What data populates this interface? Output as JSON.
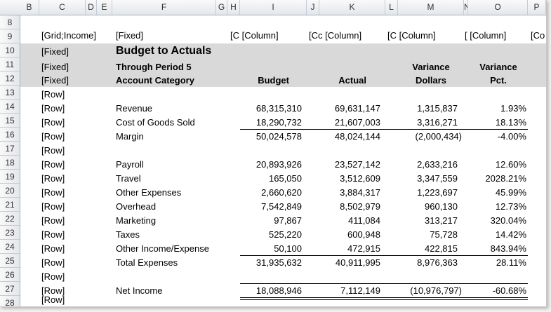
{
  "columns": [
    "B",
    "C",
    "D",
    "E",
    "F",
    "G",
    "H",
    "I",
    "J",
    "K",
    "L",
    "M",
    "N",
    "O",
    "P"
  ],
  "rows": [
    "8",
    "9",
    "10",
    "11",
    "12",
    "13",
    "14",
    "15",
    "16",
    "17",
    "18",
    "19",
    "20",
    "21",
    "22",
    "23",
    "24",
    "25",
    "26",
    "27",
    "28"
  ],
  "header_row9": {
    "c": "[Grid;Income]",
    "f": "[Fixed]",
    "h": "[C [Column]",
    "j": "[Cc [Column]",
    "l": "[C [Column]",
    "n": "[ [Column]",
    "p": "[Co"
  },
  "left_labels": {
    "r10": "[Fixed]",
    "r11": "[Fixed]",
    "r12": "[Fixed]",
    "r13": "[Row]",
    "r14": "[Row]",
    "r15": "[Row]",
    "r16": "[Row]",
    "r17": "[Row]",
    "r18": "[Row]",
    "r19": "[Row]",
    "r20": "[Row]",
    "r21": "[Row]",
    "r22": "[Row]",
    "r23": "[Row]",
    "r24": "[Row]",
    "r25": "[Row]",
    "r26": "[Row]",
    "r27": "[Row]",
    "r28": "[Row]"
  },
  "report": {
    "title": "Budget to Actuals",
    "subtitle": "Through Period 5",
    "col_category": "Account Category",
    "col_budget": "Budget",
    "col_actual": "Actual",
    "col_var1_top": "Variance",
    "col_var1_bottom": "Dollars",
    "col_var2_top": "Variance",
    "col_var2_bottom": "Pct."
  },
  "lines": [
    {
      "label": "Revenue",
      "budget": "68,315,310",
      "actual": "69,631,147",
      "var": "1,315,837",
      "pct": "1.93%"
    },
    {
      "label": "Cost of Goods Sold",
      "budget": "18,290,732",
      "actual": "21,607,003",
      "var": "3,316,271",
      "pct": "18.13%"
    },
    {
      "label": "Margin",
      "budget": "50,024,578",
      "actual": "48,024,144",
      "var": "(2,000,434)",
      "pct": "-4.00%"
    },
    {
      "label": "Payroll",
      "budget": "20,893,926",
      "actual": "23,527,142",
      "var": "2,633,216",
      "pct": "12.60%"
    },
    {
      "label": "Travel",
      "budget": "165,050",
      "actual": "3,512,609",
      "var": "3,347,559",
      "pct": "2028.21%"
    },
    {
      "label": "Other Expenses",
      "budget": "2,660,620",
      "actual": "3,884,317",
      "var": "1,223,697",
      "pct": "45.99%"
    },
    {
      "label": "Overhead",
      "budget": "7,542,849",
      "actual": "8,502,979",
      "var": "960,130",
      "pct": "12.73%"
    },
    {
      "label": "Marketing",
      "budget": "97,867",
      "actual": "411,084",
      "var": "313,217",
      "pct": "320.04%"
    },
    {
      "label": "Taxes",
      "budget": "525,220",
      "actual": "600,948",
      "var": "75,728",
      "pct": "14.42%"
    },
    {
      "label": "Other Income/Expense",
      "budget": "50,100",
      "actual": "472,915",
      "var": "422,815",
      "pct": "843.94%"
    },
    {
      "label": "Total Expenses",
      "budget": "31,935,632",
      "actual": "40,911,995",
      "var": "8,976,363",
      "pct": "28.11%"
    },
    {
      "label": "Net Income",
      "budget": "18,088,946",
      "actual": "7,112,149",
      "var": "(10,976,797)",
      "pct": "-60.68%"
    }
  ]
}
